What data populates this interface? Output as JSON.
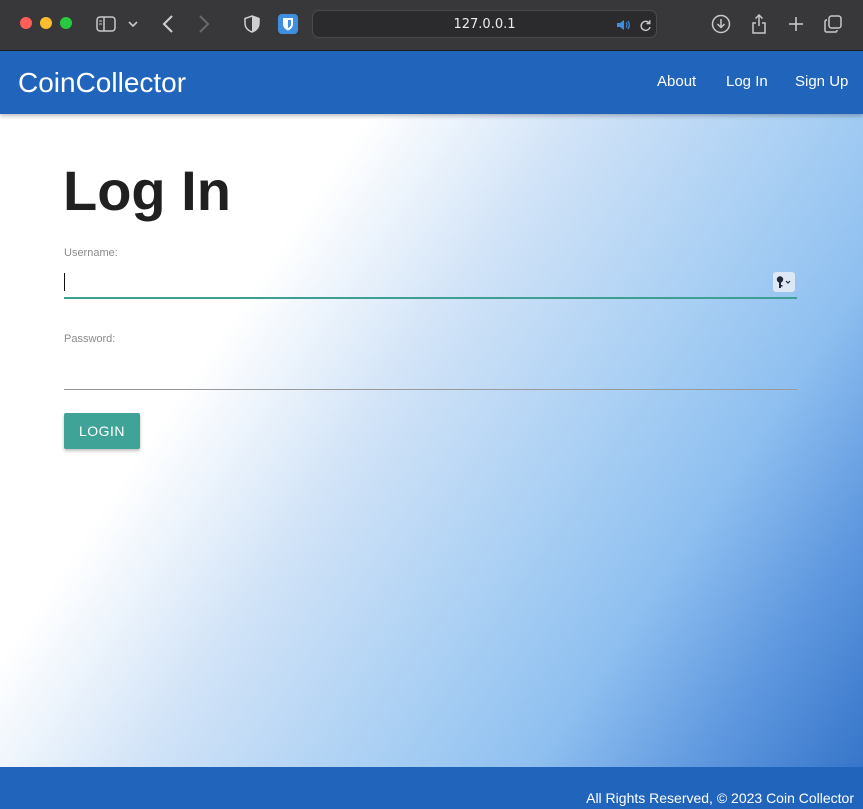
{
  "browser": {
    "url": "127.0.0.1",
    "icons": [
      "sidebar-icon",
      "chevron-down-icon",
      "back-arrow-icon",
      "forward-arrow-icon",
      "shield-icon",
      "bitwarden-icon",
      "speaker-icon",
      "reload-icon",
      "download-icon",
      "share-icon",
      "plus-icon",
      "tabs-icon"
    ]
  },
  "navbar": {
    "brand": "CoinCollector",
    "links": [
      "About",
      "Log In",
      "Sign Up"
    ]
  },
  "form": {
    "title": "Log In",
    "username_label": "Username:",
    "username_value": "",
    "password_label": "Password:",
    "password_value": "",
    "submit_label": "LOGIN"
  },
  "footer": {
    "text": "All Rights Reserved, © 2023 Coin Collector"
  },
  "colors": {
    "navbar": "#2164bb",
    "button": "#3fa497",
    "focus_underline": "#3e9e93"
  }
}
